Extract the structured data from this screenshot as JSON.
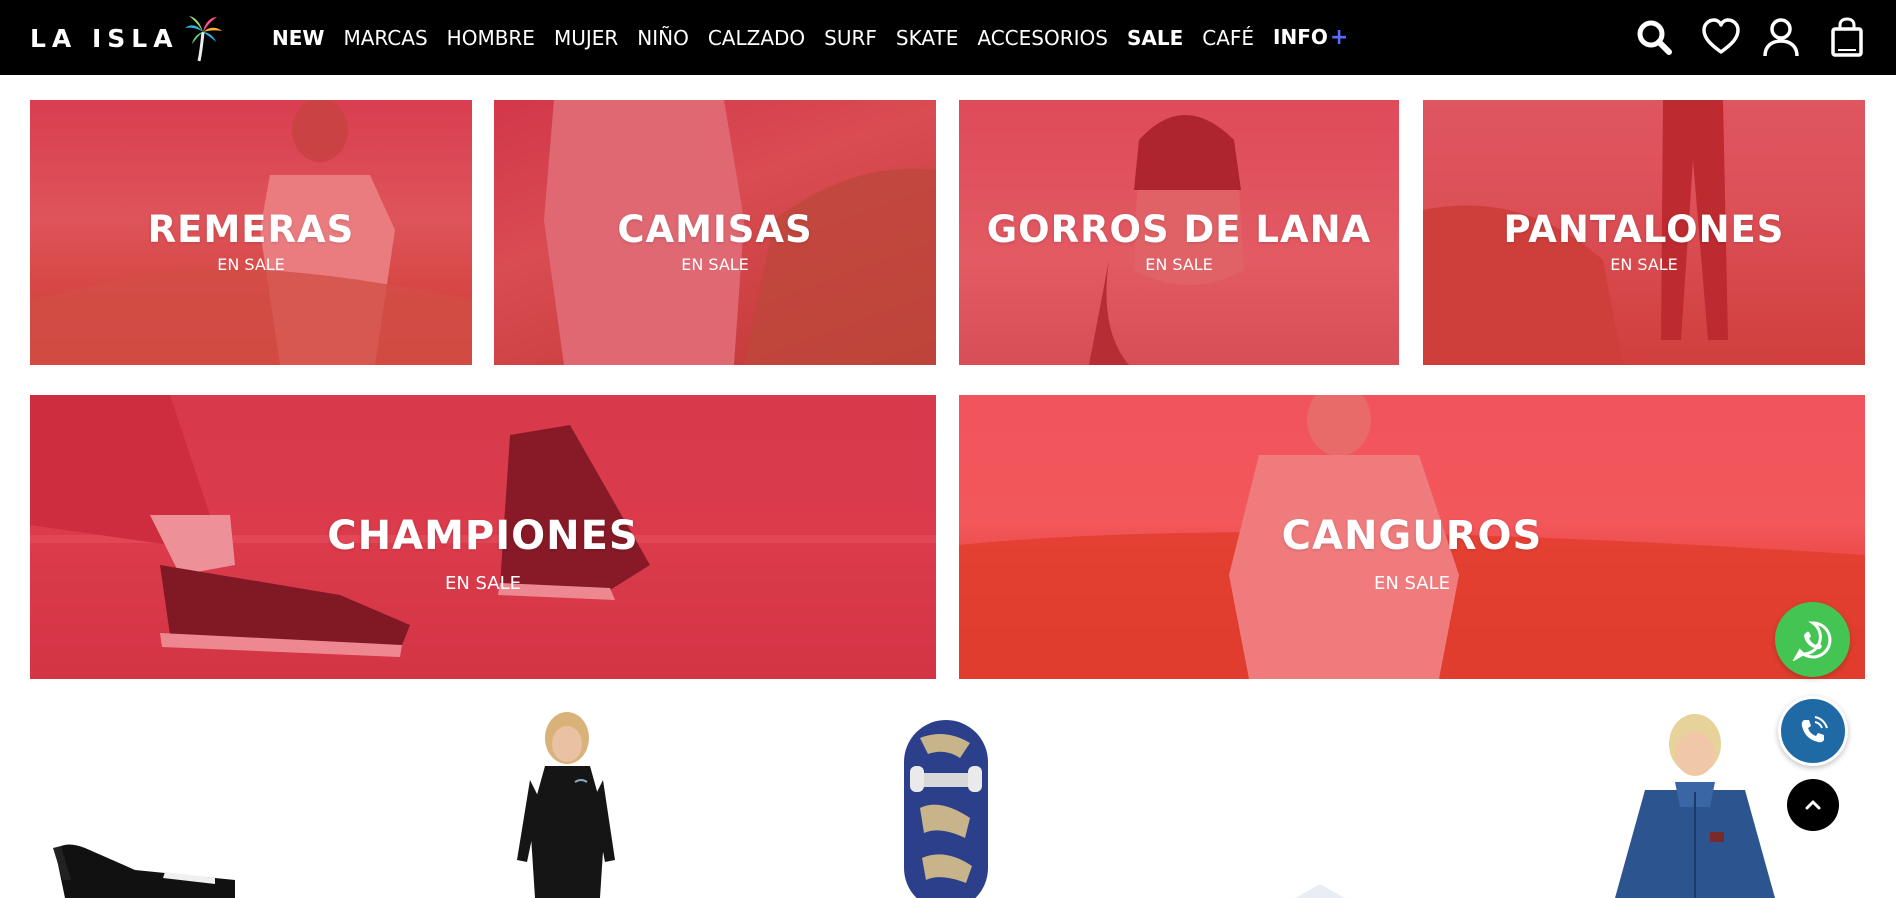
{
  "brand": {
    "logo_text": "LA ISLA"
  },
  "nav": [
    {
      "label": "NEW",
      "bold": true
    },
    {
      "label": "MARCAS",
      "bold": false
    },
    {
      "label": "HOMBRE",
      "bold": false
    },
    {
      "label": "MUJER",
      "bold": false
    },
    {
      "label": "NIÑO",
      "bold": false
    },
    {
      "label": "CALZADO",
      "bold": false
    },
    {
      "label": "SURF",
      "bold": false
    },
    {
      "label": "SKATE",
      "bold": false
    },
    {
      "label": "ACCESORIOS",
      "bold": false
    },
    {
      "label": "SALE",
      "bold": true
    },
    {
      "label": "CAFÉ",
      "bold": false
    },
    {
      "label": "INFO",
      "bold": true
    }
  ],
  "nav_extra": {
    "info_plus": "+"
  },
  "header_icons": [
    "search-icon",
    "heart-icon",
    "user-icon",
    "shopping-bag-icon"
  ],
  "categories": [
    {
      "title": "REMERAS",
      "subtitle": "EN SALE"
    },
    {
      "title": "CAMISAS",
      "subtitle": "EN SALE"
    },
    {
      "title": "GORROS DE LANA",
      "subtitle": "EN SALE"
    },
    {
      "title": "PANTALONES",
      "subtitle": "EN SALE"
    },
    {
      "title": "CHAMPIONES",
      "subtitle": "EN SALE"
    },
    {
      "title": "CANGUROS",
      "subtitle": "EN SALE"
    }
  ],
  "colors": {
    "header_bg": "#000000",
    "overlay_red": "#e82a3c",
    "whatsapp_green": "#44c553",
    "call_blue": "#1f6aa5",
    "info_plus": "#5a6bff"
  },
  "floating_buttons": [
    "whatsapp-icon",
    "phone-icon",
    "chevron-up-icon"
  ]
}
